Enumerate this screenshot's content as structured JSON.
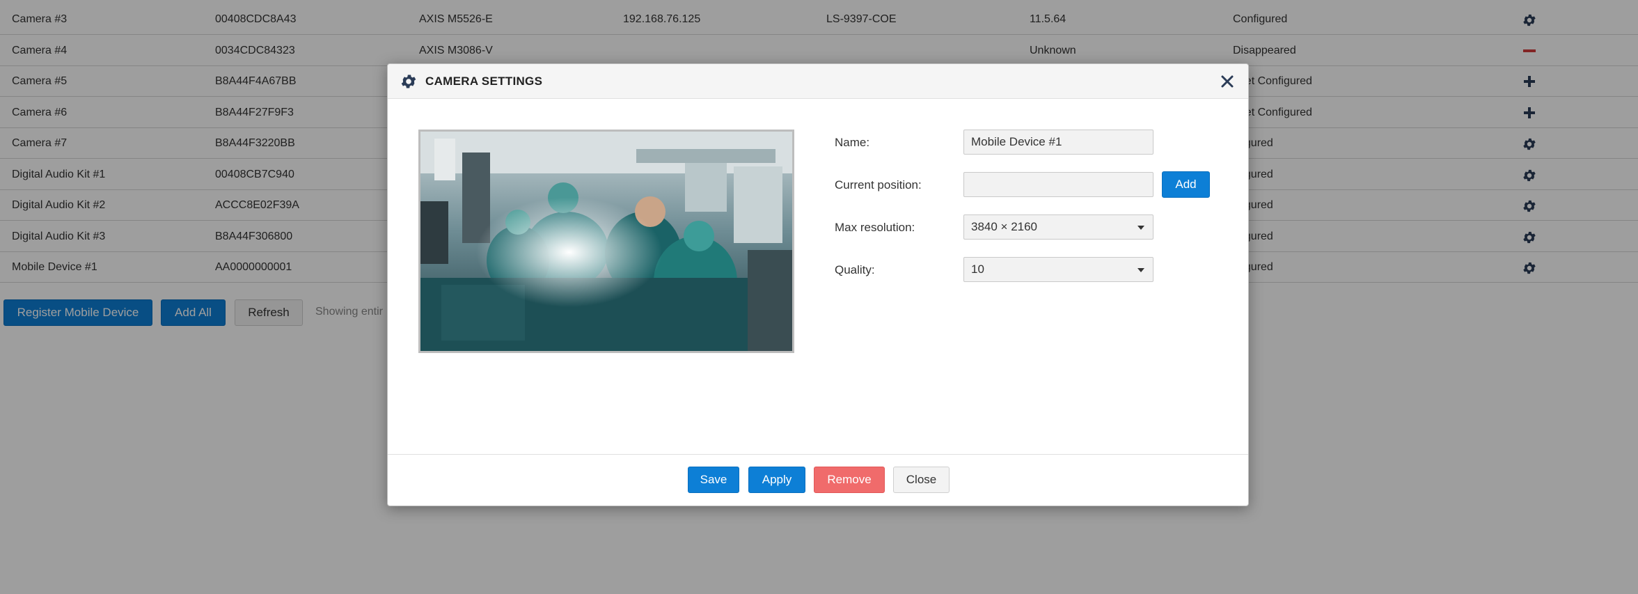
{
  "table": {
    "rows": [
      {
        "name": "Camera #3",
        "id": "00408CDC8A43",
        "model": "AXIS M5526-E",
        "ip": "192.168.76.125",
        "serial": "LS-9397-COE",
        "firmware": "11.5.64",
        "status": "Configured",
        "action_icon": "gear-icon"
      },
      {
        "name": "Camera #4",
        "id": "0034CDC84323",
        "model": "AXIS M3086-V",
        "ip": "",
        "serial": "",
        "firmware": "Unknown",
        "status": "Disappeared",
        "action_icon": "minus-icon"
      },
      {
        "name": "Camera #5",
        "id": "B8A44F4A67BB",
        "model": "",
        "ip": "",
        "serial": "",
        "firmware": "",
        "status": "t Yet Configured",
        "action_icon": "plus-icon"
      },
      {
        "name": "Camera #6",
        "id": "B8A44F27F9F3",
        "model": "",
        "ip": "",
        "serial": "",
        "firmware": "",
        "status": "t Yet Configured",
        "action_icon": "plus-icon"
      },
      {
        "name": "Camera #7",
        "id": "B8A44F3220BB",
        "model": "",
        "ip": "",
        "serial": "",
        "firmware": "",
        "status": "nfigured",
        "action_icon": "gear-icon"
      },
      {
        "name": "Digital Audio Kit #1",
        "id": "00408CB7C940",
        "model": "",
        "ip": "",
        "serial": "",
        "firmware": "",
        "status": "nfigured",
        "action_icon": "gear-icon"
      },
      {
        "name": "Digital Audio Kit #2",
        "id": "ACCC8E02F39A",
        "model": "",
        "ip": "",
        "serial": "",
        "firmware": "",
        "status": "nfigured",
        "action_icon": "gear-icon"
      },
      {
        "name": "Digital Audio Kit #3",
        "id": "B8A44F306800",
        "model": "",
        "ip": "",
        "serial": "",
        "firmware": "",
        "status": "nfigured",
        "action_icon": "gear-icon"
      },
      {
        "name": "Mobile Device #1",
        "id": "AA0000000001",
        "model": "",
        "ip": "",
        "serial": "",
        "firmware": "",
        "status": "nfigured",
        "action_icon": "gear-icon"
      }
    ]
  },
  "toolbar": {
    "register_label": "Register Mobile Device",
    "add_all_label": "Add All",
    "refresh_label": "Refresh",
    "showing_text": "Showing entir"
  },
  "modal": {
    "title": "CAMERA SETTINGS",
    "name_label": "Name:",
    "name_value": "Mobile Device #1",
    "position_label": "Current position:",
    "position_value": "",
    "add_label": "Add",
    "max_res_label": "Max resolution:",
    "max_res_value": "3840 × 2160",
    "quality_label": "Quality:",
    "quality_value": "10",
    "save_label": "Save",
    "apply_label": "Apply",
    "remove_label": "Remove",
    "close_label": "Close"
  },
  "colors": {
    "primary": "#0d7fd6",
    "danger": "#f06b6b",
    "icon": "#2b3c57",
    "minus": "#d23b3b"
  }
}
